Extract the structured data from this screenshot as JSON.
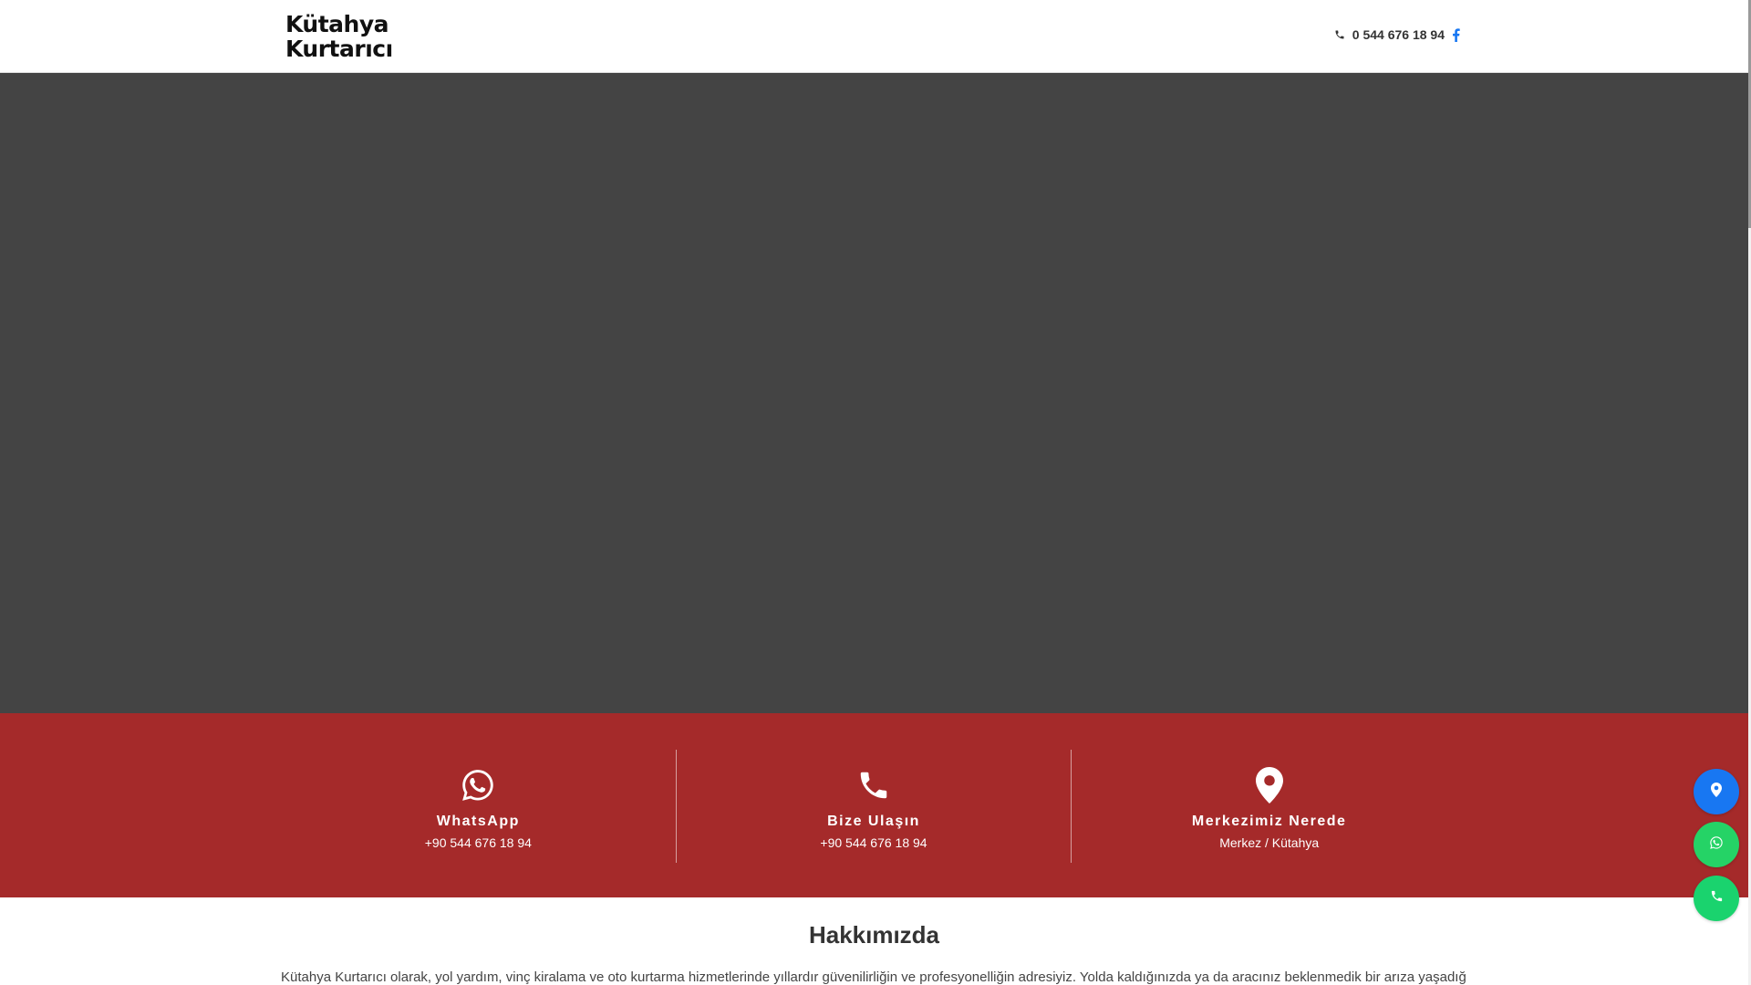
{
  "header": {
    "logo_line1": "Kütahya",
    "logo_line2": "Kurtarıcı",
    "phone": "0 544 676 18 94",
    "phone_icon": "phone-icon",
    "social_icon": "facebook-icon"
  },
  "colors": {
    "hero_bg": "#444444",
    "band_bg": "#a52a2a",
    "facebook": "#1877f2",
    "whatsapp": "#25d366"
  },
  "contact_band": [
    {
      "icon": "whatsapp-icon",
      "title": "WhatsApp",
      "value": "+90 544 676 18 94"
    },
    {
      "icon": "phone-icon",
      "title": "Bize Ulaşın",
      "value": "+90 544 676 18 94"
    },
    {
      "icon": "map-pin-icon",
      "title": "Merkezimiz Nerede",
      "value": "Merkez / Kütahya"
    }
  ],
  "about": {
    "title": "Hakkımızda",
    "text": "Kütahya Kurtarıcı olarak, yol yardım, vinç kiralama ve oto kurtarma hizmetlerinde yıllardır güvenilirliğin ve profesyonelliğin adresiyiz. Yolda kaldığınızda ya da aracınız beklenmedik bir arıza yaşadığında"
  },
  "floating_buttons": [
    {
      "icon": "map-pin-icon"
    },
    {
      "icon": "whatsapp-icon"
    },
    {
      "icon": "phone-icon"
    }
  ]
}
